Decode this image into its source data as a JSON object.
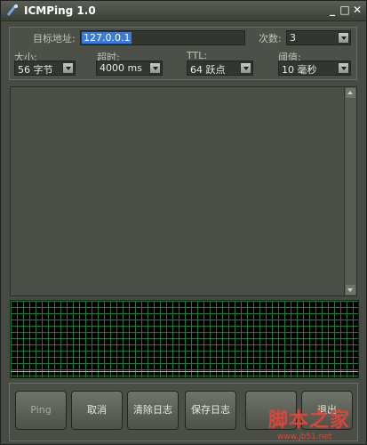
{
  "window": {
    "title": "ICMPing 1.0",
    "minimize": "_",
    "maximize": "□",
    "close": "✕"
  },
  "top": {
    "target_label": "目标地址:",
    "target_value": "127.0.0.1",
    "count_label": "次数:",
    "count_value": "3",
    "size_label": "大小:",
    "size_value": "56 字节",
    "timeout_label": "超时:",
    "timeout_value": "4000 ms",
    "ttl_label": "TTL:",
    "ttl_value": "64 跃点",
    "threshold_label": "阈值:",
    "threshold_value": "10 毫秒"
  },
  "buttons": {
    "ping": "Ping",
    "cancel": "取消",
    "clear_log": "清除日志",
    "save_log": "保存日志",
    "btn5": "",
    "exit": "退出"
  },
  "watermark": {
    "text": "脚本之家",
    "url": "www.jb51.net"
  },
  "colors": {
    "graph_grid": "#1f7a3a",
    "graph_line": "#36ff5a",
    "selection": "#3b7bd8"
  }
}
